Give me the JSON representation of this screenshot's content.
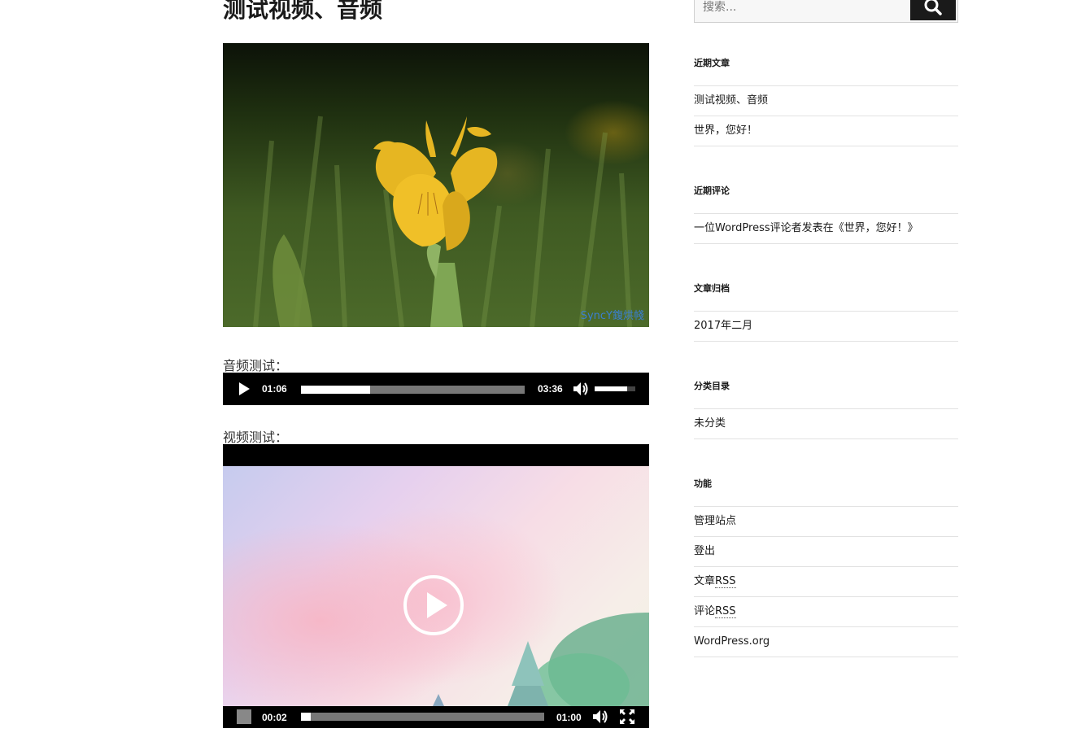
{
  "post": {
    "title": "测试视频、音频",
    "image_watermark": "SyncY鍑烘帴",
    "audio_label": "音频测试：",
    "video_label": "视频测试："
  },
  "audio_player": {
    "current_time": "01:06",
    "duration": "03:36",
    "progress": 0.31,
    "volume": 0.8
  },
  "video_player": {
    "current_time": "00:02",
    "duration": "01:00",
    "progress": 0.04
  },
  "search": {
    "placeholder": "搜索..."
  },
  "sidebar": {
    "recent_posts": {
      "title": "近期文章",
      "items": [
        "测试视频、音频",
        "世界，您好！"
      ]
    },
    "recent_comments": {
      "title": "近期评论",
      "items": [
        "一位WordPress评论者发表在《世界，您好！》"
      ]
    },
    "archives": {
      "title": "文章归档",
      "items": [
        "2017年二月"
      ]
    },
    "categories": {
      "title": "分类目录",
      "items": [
        "未分类"
      ]
    },
    "meta": {
      "title": "功能",
      "items": [
        "管理站点",
        "登出",
        "文章",
        "评论",
        "WordPress.org"
      ],
      "rss_suffix": "RSS"
    }
  },
  "colors": {
    "player_bg": "#000000",
    "search_button": "#1a1a1a",
    "divider": "#e2e2e2"
  }
}
